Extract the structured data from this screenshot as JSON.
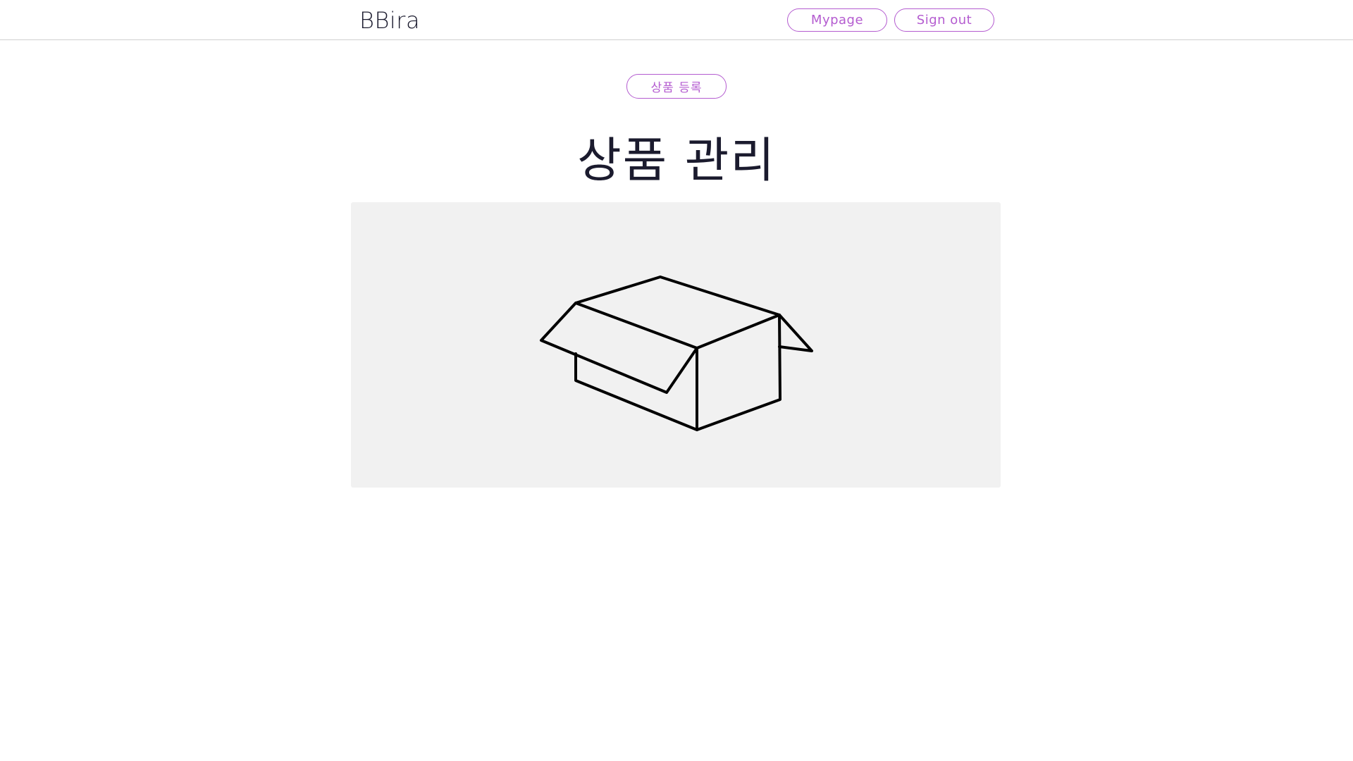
{
  "header": {
    "logo": "BBira",
    "mypage_label": "Mypage",
    "signout_label": "Sign out"
  },
  "main": {
    "register_label": "상품 등록",
    "title": "상품 관리",
    "empty_state_icon": "empty-box-icon"
  },
  "colors": {
    "accent": "#b45cd0",
    "text": "#1b1b2e",
    "panel": "#f1f1f1"
  }
}
